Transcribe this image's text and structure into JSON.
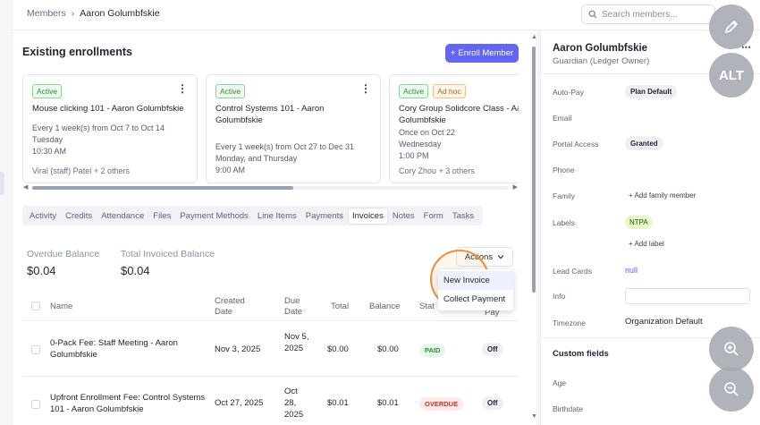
{
  "breadcrumb": {
    "root": "Members",
    "separator": "›",
    "current": "Aaron Golumbfskie"
  },
  "search": {
    "placeholder": "Search members..."
  },
  "enrollments": {
    "title": "Existing enrollments",
    "enroll_button": "Enroll Member",
    "cards": [
      {
        "badges": [
          "Active"
        ],
        "title": "Mouse clicking 101 - Aaron Golumbfskie",
        "schedule": [
          "Every 1 week(s) from Oct 7 to Oct 14",
          "Tuesday",
          "10:30 AM"
        ],
        "footer": "Viral (staff) Patel + 2 others"
      },
      {
        "badges": [
          "Active"
        ],
        "title": "Control Systems 101 - Aaron Golumbfskie",
        "schedule": [
          "Every 1 week(s) from Oct 27 to Dec 31",
          "Monday, and Thursday",
          "9:00 AM"
        ],
        "footer": ""
      },
      {
        "badges": [
          "Active",
          "Ad hoc"
        ],
        "title": "Cory Group Solidcore Class - Aaron Golumbfskie",
        "schedule": [
          "Once on Oct 22",
          "Wednesday",
          "1:00 PM"
        ],
        "footer": "Cory Zhou + 3 others"
      }
    ]
  },
  "tabs": [
    "Activity",
    "Credits",
    "Attendance",
    "Files",
    "Payment Methods",
    "Line Items",
    "Payments",
    "Invoices",
    "Notes",
    "Form",
    "Tasks"
  ],
  "active_tab": "Invoices",
  "balances": {
    "overdue_label": "Overdue Balance",
    "overdue_value": "$0.04",
    "invoiced_label": "Total Invoiced Balance",
    "invoiced_value": "$0.04"
  },
  "actions": {
    "label": "Actions",
    "menu": [
      "New Invoice",
      "Collect Payment"
    ]
  },
  "table": {
    "headers": {
      "name": "Name",
      "created": "Created Date",
      "due": "Due Date",
      "total": "Total",
      "balance": "Balance",
      "status": "Stat",
      "autopay": "Pay"
    },
    "rows": [
      {
        "name": "0-Pack Fee: Staff Meeting - Aaron Golumbfskie",
        "created": "Nov 3, 2025",
        "due": "Nov 5, 2025",
        "total": "$0.00",
        "balance": "$0.00",
        "status": "PAID",
        "autopay": "Off"
      },
      {
        "name": "Upfront Enrollment Fee: Control Systems 101 - Aaron Golumbfskie",
        "created": "Oct 27, 2025",
        "due": "Oct 28, 2025",
        "total": "$0.01",
        "balance": "$0.01",
        "status": "OVERDUE",
        "autopay": "Off"
      }
    ]
  },
  "profile": {
    "name": "Aaron Golumbfskie",
    "role": "Guardian (Ledger Owner)",
    "more": "⋯",
    "fields": {
      "autopay_label": "Auto-Pay",
      "autopay_value": "Plan Default",
      "email_label": "Email",
      "portal_label": "Portal Access",
      "portal_value": "Granted",
      "phone_label": "Phone",
      "family_label": "Family",
      "family_add": "Add family member",
      "labels_label": "Labels",
      "labels_value": "NTPA",
      "labels_add": "Add label",
      "leadcards_label": "Lead Cards",
      "leadcards_value": "null",
      "info_label": "Info",
      "timezone_label": "Timezone",
      "timezone_value": "Organization Default"
    },
    "custom_fields_title": "Custom fields",
    "custom": {
      "age_label": "Age",
      "birthdate_label": "Birthdate"
    }
  },
  "overlay": {
    "alt_label": "ALT"
  },
  "colors": {
    "accent": "#6366f1",
    "paid": "#2f8a3a",
    "overdue": "#c2362e",
    "highlight_ring": "#f28c36"
  }
}
